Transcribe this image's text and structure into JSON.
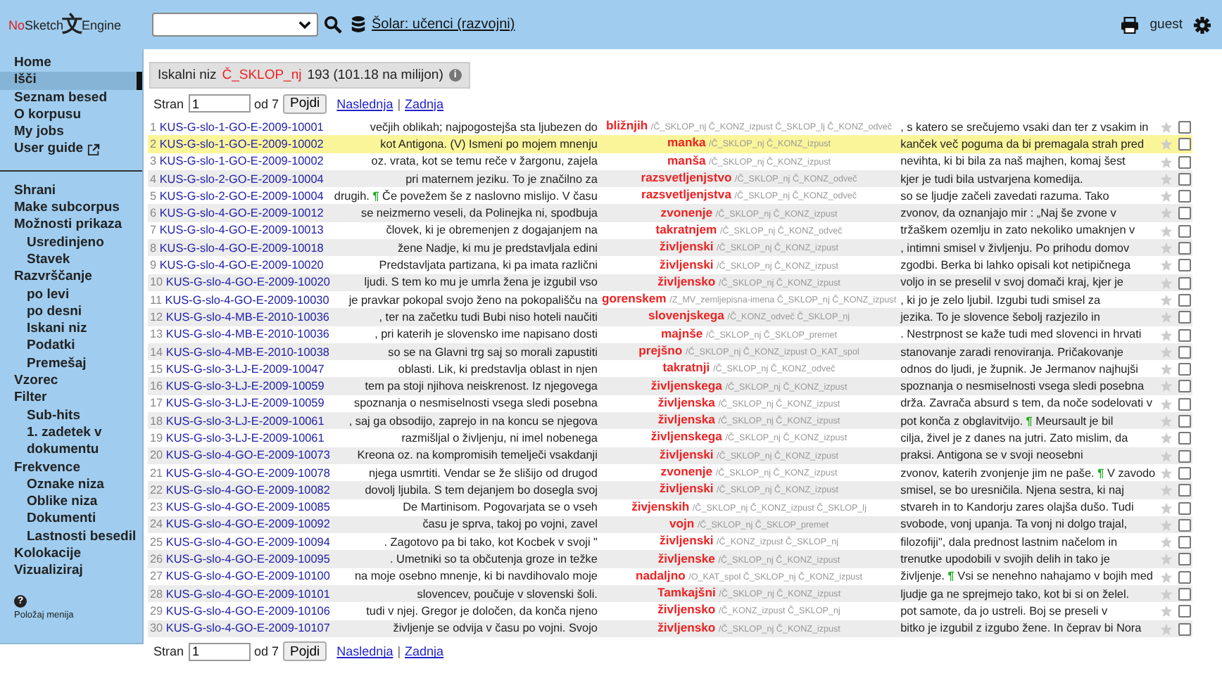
{
  "header": {
    "logo": {
      "prefix": "No",
      "name": "Sketch",
      "glyph": "文",
      "suffix": "Engine"
    },
    "corpus_link": "Šolar: učenci (razvojni)",
    "user": "guest"
  },
  "sidebar": {
    "groups": [
      {
        "items": [
          {
            "label": "Home",
            "selected": false
          },
          {
            "label": "Išči",
            "selected": true
          },
          {
            "label": "Seznam besed",
            "selected": false
          },
          {
            "label": "O korpusu",
            "selected": false
          },
          {
            "label": "My jobs",
            "selected": false
          },
          {
            "label": "User guide",
            "selected": false,
            "external": true
          }
        ]
      },
      {
        "items": [
          {
            "label": "Shrani",
            "selected": false
          },
          {
            "label": "Make subcorpus",
            "selected": false
          },
          {
            "label": "Možnosti prikaza",
            "selected": false,
            "children": [
              {
                "label": "Usredinjeno",
                "selected": false
              },
              {
                "label": "Stavek",
                "selected": false
              }
            ]
          },
          {
            "label": "Razvrščanje",
            "selected": false,
            "children": [
              {
                "label": "po levi",
                "selected": false
              },
              {
                "label": "po desni",
                "selected": false
              },
              {
                "label": "Iskani niz",
                "selected": false
              },
              {
                "label": "Podatki",
                "selected": false
              },
              {
                "label": "Premešaj",
                "selected": false
              }
            ]
          },
          {
            "label": "Vzorec",
            "selected": false
          },
          {
            "label": "Filter",
            "selected": false,
            "children": [
              {
                "label": "Sub-hits",
                "selected": false
              },
              {
                "label": "1. zadetek v dokumentu",
                "selected": false
              }
            ]
          },
          {
            "label": "Frekvence",
            "selected": false,
            "children": [
              {
                "label": "Oznake niza",
                "selected": false
              },
              {
                "label": "Oblike niza",
                "selected": false
              },
              {
                "label": "Dokumenti",
                "selected": false
              },
              {
                "label": "Lastnosti besedil",
                "selected": false
              }
            ]
          },
          {
            "label": "Kolokacije",
            "selected": false
          },
          {
            "label": "Vizualiziraj",
            "selected": false
          }
        ]
      }
    ],
    "help": "?",
    "position_link": "Položaj menija"
  },
  "summary": {
    "label": "Iskalni niz",
    "query": "Č_SKLOP_nj",
    "count": "193 (101.18 na milijon)",
    "info": "i"
  },
  "pager_top": {
    "label": "Stran",
    "value": "1",
    "of": "od 7",
    "button": "Pojdi",
    "next": "Naslednja",
    "separator": "|",
    "last": "Zadnja"
  },
  "rows": [
    {
      "n": "1",
      "ref": "KUS-G-slo-1-GO-E-2009-10001",
      "left": "večjih oblikah; najpogostejša sta ljubezen do",
      "kwic": "bližnjih",
      "tags": "/Č_SKLOP_nj Č_KONZ_izpust Č_SKLOP_lj Č_KONZ_odveč",
      "right": ", s katero se srečujemo vsaki dan ter z vsakim in",
      "selected": false,
      "checked": false
    },
    {
      "n": "2",
      "ref": "KUS-G-slo-1-GO-E-2009-10002",
      "left": "kot Antigona. (V) Ismeni po mojem mnenju",
      "kwic": "manka",
      "tags": "/Č_SKLOP_nj Č_KONZ_izpust",
      "right": "kanček več poguma da bi premagala strah pred",
      "selected": true,
      "checked": false
    },
    {
      "n": "3",
      "ref": "KUS-G-slo-1-GO-E-2009-10002",
      "left": "oz. vrata, kot se temu reče v žargonu, zajela",
      "kwic": "manša",
      "tags": "/Č_SKLOP_nj Č_KONZ_izpust",
      "right": "nevihta, ki bi bila za naš majhen, komaj šest",
      "selected": false,
      "checked": false
    },
    {
      "n": "4",
      "ref": "KUS-G-slo-2-GO-E-2009-10004",
      "left": "pri maternem jeziku. To je značilno za",
      "kwic": "razsvetljenjstvo",
      "tags": "/Č_SKLOP_nj Č_KONZ_odveč",
      "right": "kjer je tudi bila ustvarjena komedija.",
      "selected": false,
      "checked": false
    },
    {
      "n": "5",
      "ref": "KUS-G-slo-2-GO-E-2009-10004",
      "left": [
        {
          "kind": "text",
          "text": "drugih. "
        },
        {
          "kind": "mark",
          "text": "¶"
        },
        {
          "kind": "text",
          "text": " Če povežem še z naslovno mislijo. V času"
        }
      ],
      "kwic": "razsvetljenjstva",
      "tags": "/Č_SKLOP_nj Č_KONZ_odveč",
      "right": "so se ljudje začeli zavedati razuma. Tako",
      "selected": false,
      "checked": false
    },
    {
      "n": "6",
      "ref": "KUS-G-slo-4-GO-E-2009-10012",
      "left": "se neizmerno veseli, da Polinejka ni, spodbuja",
      "kwic": "zvonenje",
      "tags": "/Č_SKLOP_nj Č_KONZ_izpust",
      "right": "zvonov, da oznanjajo mir : „Naj še zvone v",
      "selected": false,
      "checked": false
    },
    {
      "n": "7",
      "ref": "KUS-G-slo-4-GO-E-2009-10013",
      "left": "človek, ki je obremenjen z dogajanjem na",
      "kwic": "takratnjem",
      "tags": "/Č_SKLOP_nj Č_KONZ_odveč",
      "right": "tržaškem ozemlju in zato nekoliko umaknjen v",
      "selected": false,
      "checked": false
    },
    {
      "n": "8",
      "ref": "KUS-G-slo-4-GO-E-2009-10018",
      "left": "žene Nadje, ki mu je predstavljala edini",
      "kwic": "življenski",
      "tags": "/Č_SKLOP_nj Č_KONZ_izpust",
      "right": ", intimni smisel v življenju. Po prihodu domov",
      "selected": false,
      "checked": false
    },
    {
      "n": "9",
      "ref": "KUS-G-slo-4-GO-E-2009-10020",
      "left": "Predstavljata partizana, ki pa imata različni",
      "kwic": "življenski",
      "tags": "/Č_SKLOP_nj Č_KONZ_izpust",
      "right": "zgodbi. Berka bi lahko opisali kot netipičnega",
      "selected": false,
      "checked": false
    },
    {
      "n": "10",
      "ref": "KUS-G-slo-4-GO-E-2009-10020",
      "left": "ljudi. S tem ko mu je umrla žena je izgubil vso",
      "kwic": "življensko",
      "tags": "/Č_SKLOP_nj Č_KONZ_izpust",
      "right": "voljo in se preselil v svoj domači kraj, kjer je",
      "selected": false,
      "checked": false
    },
    {
      "n": "11",
      "ref": "KUS-G-slo-4-GO-E-2009-10030",
      "left": "je pravkar pokopal svojo ženo na pokopališču na",
      "kwic": "gorenskem",
      "tags": "/Z_MV_zemljepisna-imena Č_SKLOP_nj Č_KONZ_izpust",
      "right": ", ki jo je zelo ljubil. Izgubi tudi smisel za",
      "selected": false,
      "checked": false
    },
    {
      "n": "12",
      "ref": "KUS-G-slo-4-MB-E-2010-10036",
      "left": ", ter na začetku tudi Bubi niso hoteli naučiti",
      "kwic": "slovenjskega",
      "tags": "/Č_KONZ_odveč Č_SKLOP_nj",
      "right": "jezika. To je slovence šebolj razjezilo in",
      "selected": false,
      "checked": false
    },
    {
      "n": "13",
      "ref": "KUS-G-slo-4-MB-E-2010-10036",
      "left": ", pri katerih je slovensko ime napisano dosti",
      "kwic": "majnše",
      "tags": "/Č_SKLOP_nj Č_SKLOP_premet",
      "right": ". Nestrpnost se kaže tudi med slovenci in hrvati",
      "selected": false,
      "checked": false
    },
    {
      "n": "14",
      "ref": "KUS-G-slo-4-MB-E-2010-10038",
      "left": "so se na Glavni trg saj so morali zapustiti",
      "kwic": "prejšno",
      "tags": "/Č_SKLOP_nj Č_KONZ_izpust O_KAT_spol",
      "right": "stanovanje zaradi renoviranja. Pričakovanje",
      "selected": false,
      "checked": false
    },
    {
      "n": "15",
      "ref": "KUS-G-slo-3-LJ-E-2009-10047",
      "left": "oblasti. Lik, ki predstavlja oblast in njen",
      "kwic": "takratnji",
      "tags": "/Č_SKLOP_nj Č_KONZ_odveč",
      "right": "odnos do ljudi, je župnik. Je Jermanov najhujši",
      "selected": false,
      "checked": false
    },
    {
      "n": "16",
      "ref": "KUS-G-slo-3-LJ-E-2009-10059",
      "left": "tem pa stoji njihova neiskrenost. Iz njegovega",
      "kwic": "življenskega",
      "tags": "/Č_SKLOP_nj Č_KONZ_izpust",
      "right": "spoznanja o nesmiselnosti vsega sledi posebna",
      "selected": false,
      "checked": false
    },
    {
      "n": "17",
      "ref": "KUS-G-slo-3-LJ-E-2009-10059",
      "left": "spoznanja o nesmiselnosti vsega sledi posebna",
      "kwic": "življenska",
      "tags": "/Č_SKLOP_nj Č_KONZ_izpust",
      "right": "drža. Zavrača absurd s tem, da noče sodelovati v",
      "selected": false,
      "checked": false
    },
    {
      "n": "18",
      "ref": "KUS-G-slo-3-LJ-E-2009-10061",
      "left": ", saj ga obsodijo, zaprejo in na koncu se njegova",
      "kwic": "življenska",
      "tags": "/Č_SKLOP_nj Č_KONZ_izpust",
      "right": [
        {
          "kind": "text",
          "text": "pot konča z obglavitvijo. "
        },
        {
          "kind": "mark",
          "text": "¶"
        },
        {
          "kind": "text",
          "text": " Meursault je bil"
        }
      ],
      "selected": false,
      "checked": false
    },
    {
      "n": "19",
      "ref": "KUS-G-slo-3-LJ-E-2009-10061",
      "left": "razmišljal o življenju, ni imel nobenega",
      "kwic": "življenskega",
      "tags": "/Č_SKLOP_nj Č_KONZ_izpust",
      "right": "cilja, živel je z danes na jutri. Zato mislim, da",
      "selected": false,
      "checked": false
    },
    {
      "n": "20",
      "ref": "KUS-G-slo-4-GO-E-2009-10073",
      "left": "Kreona oz. na kompromisih temelječi vsakdanji",
      "kwic": "življenski",
      "tags": "/Č_SKLOP_nj Č_KONZ_izpust",
      "right": "praksi. Antigona se v svoji neosebni",
      "selected": false,
      "checked": false
    },
    {
      "n": "21",
      "ref": "KUS-G-slo-4-GO-E-2009-10078",
      "left": "njega usmrtiti. Vendar se že slišijo od drugod",
      "kwic": "zvonenje",
      "tags": "/Č_SKLOP_nj Č_KONZ_izpust",
      "right": [
        {
          "kind": "text",
          "text": "zvonov, katerih zvonjenje jim ne paše. "
        },
        {
          "kind": "mark",
          "text": "¶"
        },
        {
          "kind": "text",
          "text": " V zavodo"
        }
      ],
      "selected": false,
      "checked": false
    },
    {
      "n": "22",
      "ref": "KUS-G-slo-4-GO-E-2009-10082",
      "left": "dovolj ljubila. S tem dejanjem bo dosegla svoj",
      "kwic": "življenski",
      "tags": "/Č_SKLOP_nj Č_KONZ_izpust",
      "right": "smisel, se bo uresničila. Njena sestra, ki naj",
      "selected": false,
      "checked": false
    },
    {
      "n": "23",
      "ref": "KUS-G-slo-4-GO-E-2009-10085",
      "left": "De Martinisom. Pogovarjata se o vseh",
      "kwic": "živjenskih",
      "tags": "/Č_SKLOP_nj Č_KONZ_izpust Č_SKLOP_lj",
      "right": "stvareh in to Kandorju zares olajša dušo. Tudi",
      "selected": false,
      "checked": false
    },
    {
      "n": "24",
      "ref": "KUS-G-slo-4-GO-E-2009-10092",
      "left": "času je sprva, takoj po vojni, zavel",
      "kwic": "vojn",
      "tags": "/Č_SKLOP_nj Č_SKLOP_premet",
      "right": "svobode, vonj upanja. Ta vonj ni dolgo trajal,",
      "selected": false,
      "checked": false
    },
    {
      "n": "25",
      "ref": "KUS-G-slo-4-GO-E-2009-10094",
      "left": ". Zagotovo pa bi tako, kot Kocbek v svoji \"",
      "kwic": "življenski",
      "tags": "/Č_KONZ_izpust Č_SKLOP_nj",
      "right": "filozofiji\", dala prednost lastnim načelom in",
      "selected": false,
      "checked": false
    },
    {
      "n": "26",
      "ref": "KUS-G-slo-4-GO-E-2009-10095",
      "left": ". Umetniki so ta občutenja groze in težke",
      "kwic": "življenske",
      "tags": "/Č_SKLOP_nj Č_KONZ_izpust",
      "right": "trenutke upodobili v svojih delih in tako je",
      "selected": false,
      "checked": false
    },
    {
      "n": "27",
      "ref": "KUS-G-slo-4-GO-E-2009-10100",
      "left": "na moje osebno mnenje, ki bi navdihovalo moje",
      "kwic": "nadaljno",
      "tags": "/O_KAT_spol Č_SKLOP_nj Č_KONZ_izpust",
      "right": [
        {
          "kind": "text",
          "text": "življenje. "
        },
        {
          "kind": "mark",
          "text": "¶"
        },
        {
          "kind": "text",
          "text": " Vsi se nenehno nahajamo v bojih med"
        }
      ],
      "selected": false,
      "checked": false
    },
    {
      "n": "28",
      "ref": "KUS-G-slo-4-GO-E-2009-10101",
      "left": "slovencev, poučuje v slovenski šoli.",
      "kwic": "Tamkajšni",
      "tags": "/Č_SKLOP_nj Č_KONZ_izpust",
      "right": "ljudje ga ne sprejmejo tako, kot bi si on želel.",
      "selected": false,
      "checked": false
    },
    {
      "n": "29",
      "ref": "KUS-G-slo-4-GO-E-2009-10106",
      "left": "tudi v njej. Gregor je določen, da konča njeno",
      "kwic": "življensko",
      "tags": "/Č_KONZ_izpust Č_SKLOP_nj",
      "right": "pot samote, da jo ustreli. Boj se preseli v",
      "selected": false,
      "checked": false
    },
    {
      "n": "30",
      "ref": "KUS-G-slo-4-GO-E-2009-10107",
      "left": "življenje se odvija v času po vojni. Svojo",
      "kwic": "življensko",
      "tags": "/Č_SKLOP_nj Č_KONZ_izpust",
      "right": "bitko je izgubil z izgubo žene. In čeprav bi Nora",
      "selected": false,
      "checked": false
    }
  ],
  "pager_bottom": {
    "label": "Stran",
    "value": "1",
    "of": "od 7",
    "button": "Pojdi",
    "next": "Naslednja",
    "separator": "|",
    "last": "Zadnja"
  }
}
